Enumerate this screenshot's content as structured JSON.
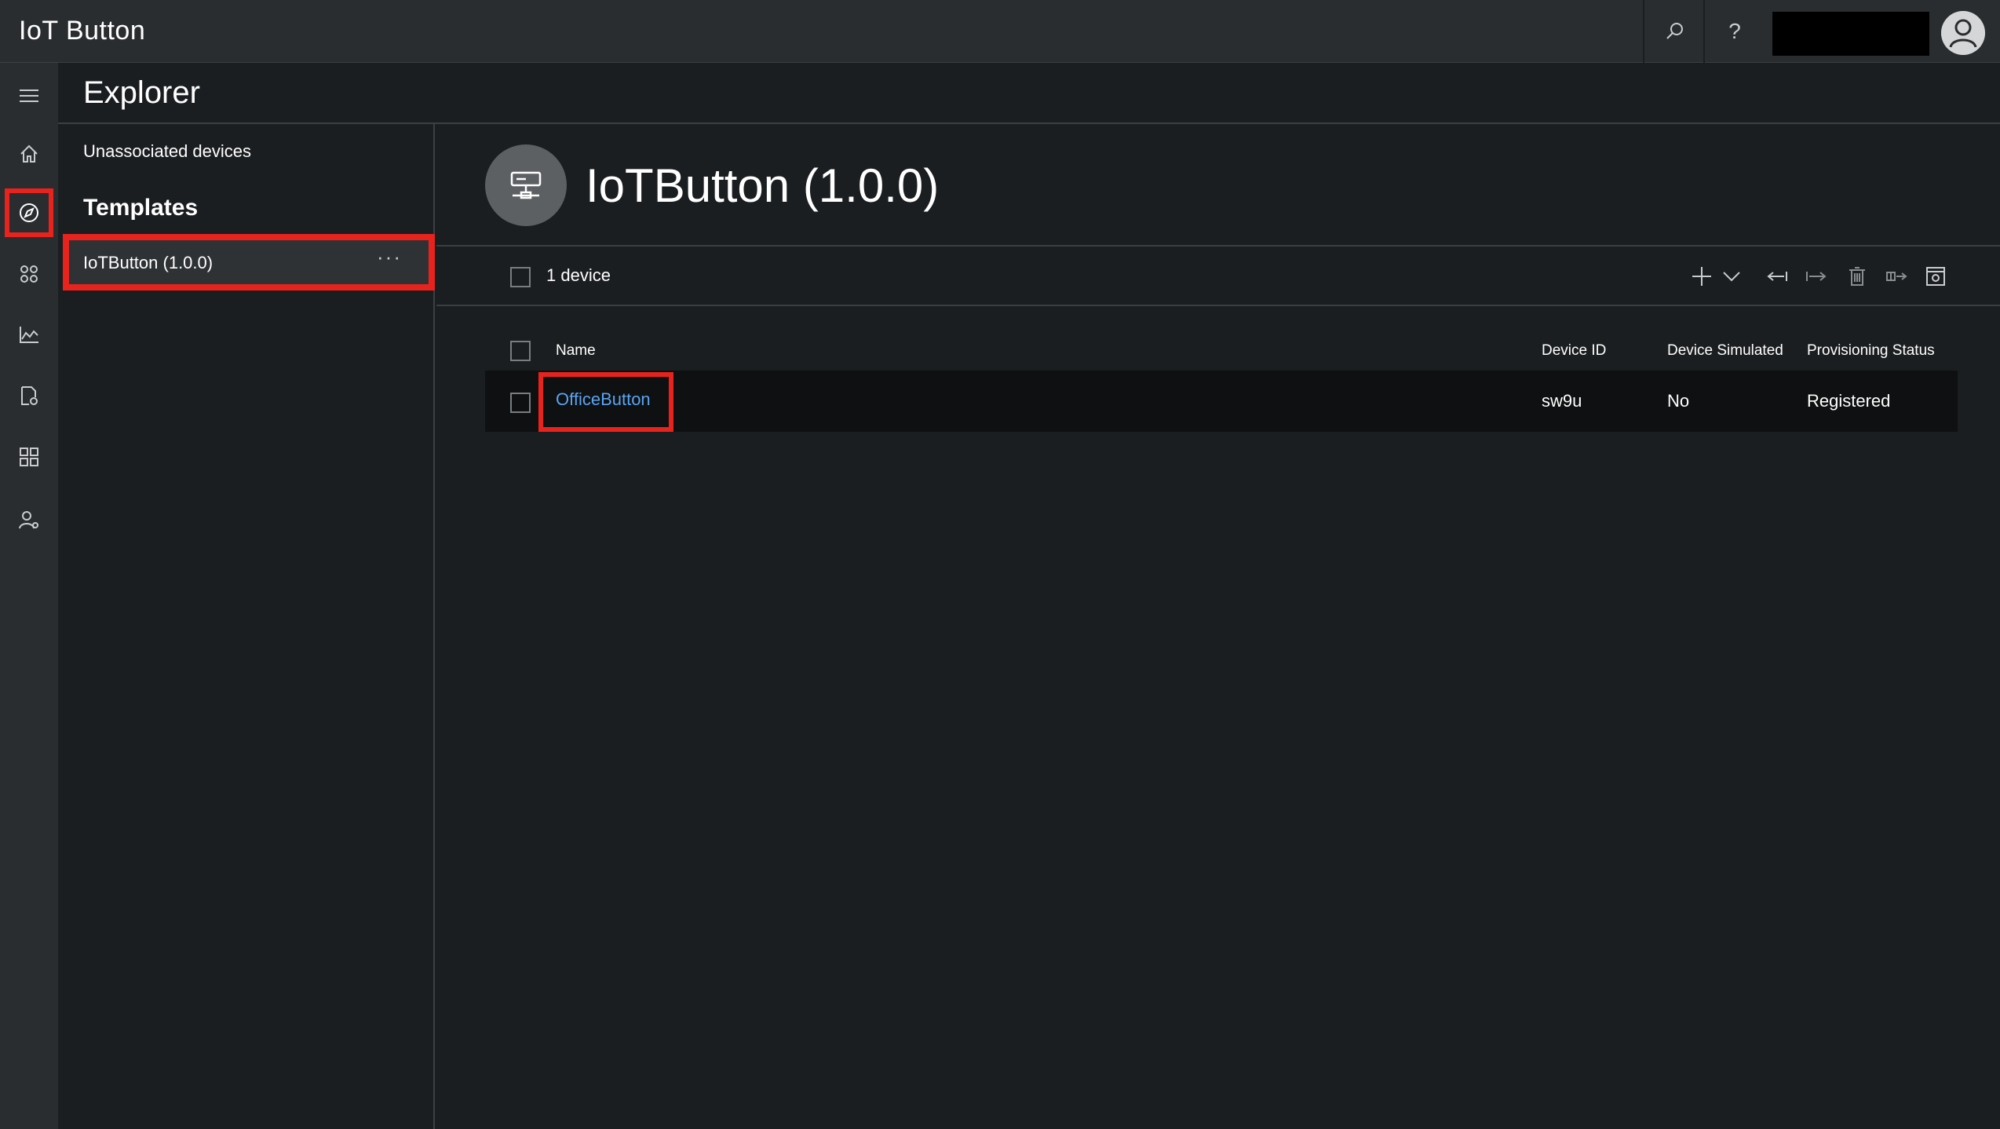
{
  "app": {
    "title": "IoT Button"
  },
  "topbar": {
    "search_icon": "search-icon",
    "help_label": "?",
    "account_name": ""
  },
  "rail": {
    "items": [
      {
        "name": "menu",
        "icon": "hamburger-icon"
      },
      {
        "name": "home",
        "icon": "home-icon"
      },
      {
        "name": "explorer",
        "icon": "explorer-icon",
        "active": true
      },
      {
        "name": "device-sets",
        "icon": "device-sets-icon"
      },
      {
        "name": "analytics",
        "icon": "analytics-icon"
      },
      {
        "name": "jobs",
        "icon": "jobs-icon"
      },
      {
        "name": "builder",
        "icon": "builder-icon"
      },
      {
        "name": "administration",
        "icon": "administration-icon"
      }
    ]
  },
  "explorer": {
    "title": "Explorer",
    "unassociated_label": "Unassociated devices",
    "templates_heading": "Templates",
    "templates": [
      {
        "label": "IoTButton (1.0.0)",
        "more": "···"
      }
    ]
  },
  "main": {
    "template_title": "IoTButton (1.0.0)",
    "device_count": "1 device",
    "toolbar": [
      "add-icon",
      "chevron-down-icon",
      "disassociate-icon",
      "migrate-icon",
      "delete-icon",
      "export-icon",
      "settings-icon"
    ],
    "columns": [
      "Name",
      "Device ID",
      "Device Simulated",
      "Provisioning Status"
    ],
    "rows": [
      {
        "name": "OfficeButton",
        "device_id": "sw9u",
        "simulated": "No",
        "status": "Registered"
      }
    ]
  },
  "colors": {
    "accent_red": "#e8231d",
    "link_blue": "#5aa4f0",
    "background": "#1b1e20",
    "chrome": "#2a2d30"
  }
}
